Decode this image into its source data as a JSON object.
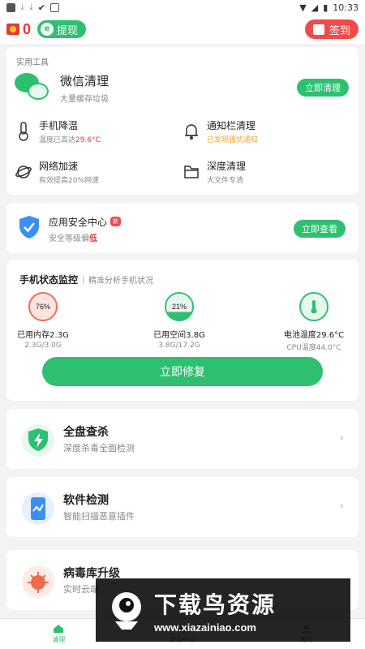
{
  "status_bar": {
    "time": "10:33"
  },
  "top_bar": {
    "coins": "0",
    "withdraw_label": "提现",
    "signin_label": "签到"
  },
  "tools": {
    "section_title": "实用工具",
    "wechat": {
      "title": "微信清理",
      "subtitle": "大量缓存垃圾",
      "button": "立即清理"
    },
    "items": [
      {
        "title": "手机降温",
        "subtitle_prefix": "温度已高达",
        "subtitle_value": "29.6°C",
        "icon": "thermometer-icon"
      },
      {
        "title": "通知栏清理",
        "subtitle": "已发现骚扰通知",
        "icon": "bell-icon"
      },
      {
        "title": "网络加速",
        "subtitle": "有效提高20%网速",
        "icon": "planet-icon"
      },
      {
        "title": "深度清理",
        "subtitle": "大文件专清",
        "icon": "folder-icon"
      }
    ]
  },
  "security": {
    "title": "应用安全中心",
    "badge": "新",
    "subtitle_prefix": "安全等级偏",
    "subtitle_value": "低",
    "button": "立即查看"
  },
  "monitor": {
    "title": "手机状态监控",
    "subtitle": "精准分析手机状况",
    "stats": [
      {
        "badge": "76%",
        "main": "已用内存2.3G",
        "sub": "2.3G/3.0G"
      },
      {
        "badge": "21%",
        "main": "已用空间3.8G",
        "sub": "3.8G/17.2G"
      },
      {
        "badge": "",
        "main": "电池温度29.6°C",
        "sub": "CPU温度44.0°C"
      }
    ],
    "fix_button": "立即修复"
  },
  "features": [
    {
      "title": "全盘查杀",
      "subtitle": "深度杀毒全面检测",
      "icon": "shield-bolt-icon"
    },
    {
      "title": "软件检测",
      "subtitle": "智能扫描恶意插件",
      "icon": "phone-scan-icon"
    },
    {
      "title": "病毒库升级",
      "subtitle": "实时云端",
      "icon": "virus-icon"
    }
  ],
  "tabbar": {
    "tabs": [
      "清理",
      "安全中心",
      "我的"
    ]
  },
  "watermark": {
    "title": "下载鸟资源",
    "url": "www.xiazainiao.com"
  },
  "colors": {
    "accent": "#2fbf71",
    "danger": "#e53935",
    "warning": "#f5a623"
  }
}
